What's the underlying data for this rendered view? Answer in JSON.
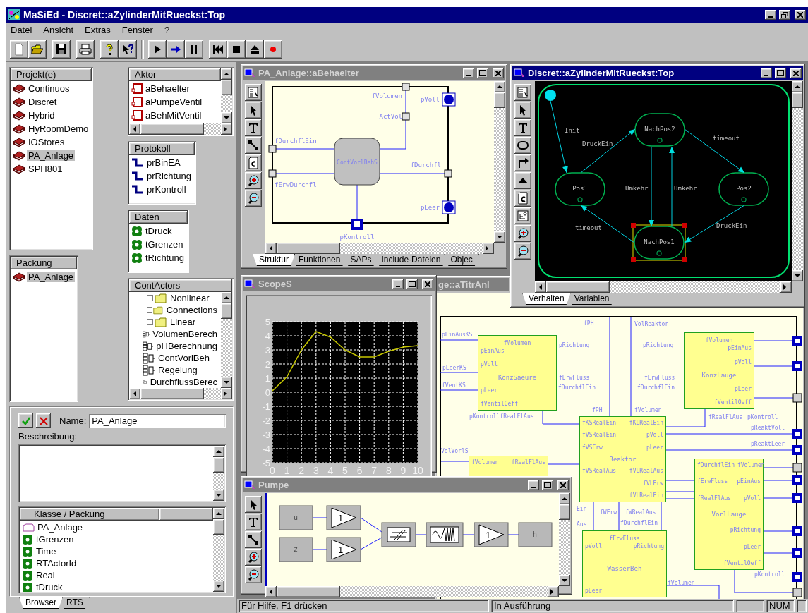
{
  "window": {
    "title": "MaSiEd - Discret::aZylinderMitRueckst:Top"
  },
  "menu": [
    "Datei",
    "Ansicht",
    "Extras",
    "Fenster",
    "?"
  ],
  "browser": {
    "projects": {
      "header": "Projekt(e)",
      "items": [
        {
          "label": "Continuos",
          "selected": false
        },
        {
          "label": "Discret",
          "selected": false
        },
        {
          "label": "Hybrid",
          "selected": false
        },
        {
          "label": "HyRoomDemo",
          "selected": false
        },
        {
          "label": "IOStores",
          "selected": false
        },
        {
          "label": "PA_Anlage",
          "selected": true
        },
        {
          "label": "SPH801",
          "selected": false
        }
      ]
    },
    "package": {
      "header": "Packung",
      "items": [
        {
          "label": "PA_Anlage",
          "selected": true
        }
      ]
    },
    "actors": {
      "header": "Aktor",
      "items": [
        "aBehaelter",
        "aPumpeVentil",
        "aBehMitVentil"
      ]
    },
    "protocols": {
      "header": "Protokoll",
      "items": [
        "prBinEA",
        "prRichtung",
        "prKontroll"
      ]
    },
    "data": {
      "header": "Daten",
      "items": [
        "tDruck",
        "tGrenzen",
        "tRichtung"
      ]
    },
    "cont_actors": {
      "header": "ContActors",
      "items": [
        {
          "label": "Nonlinear",
          "kind": "folder",
          "expanded": false
        },
        {
          "label": "Connections",
          "kind": "folder",
          "expanded": false
        },
        {
          "label": "Linear",
          "kind": "folder",
          "expanded": false
        },
        {
          "label": "VolumenBerech",
          "kind": "block"
        },
        {
          "label": "pHBerechnung",
          "kind": "block"
        },
        {
          "label": "ContVorlBeh",
          "kind": "block"
        },
        {
          "label": "Regelung",
          "kind": "block"
        },
        {
          "label": "DurchflussBerec",
          "kind": "block"
        }
      ]
    },
    "editor": {
      "name_label": "Name:",
      "name_value": "PA_Anlage",
      "description_label": "Beschreibung:",
      "class_column": "Klasse / Packung",
      "classes": [
        {
          "label": "PA_Anlage",
          "kind": "package"
        },
        {
          "label": "tGrenzen",
          "kind": "data"
        },
        {
          "label": "Time",
          "kind": "data"
        },
        {
          "label": "RTActorId",
          "kind": "data"
        },
        {
          "label": "Real",
          "kind": "data"
        },
        {
          "label": "tDruck",
          "kind": "data"
        }
      ]
    },
    "tabs": [
      {
        "label": "Browser",
        "selected": true
      },
      {
        "label": "RTS",
        "selected": false
      }
    ]
  },
  "structure_window": {
    "title": "PA_Anlage::aBehaelter",
    "active": false,
    "block": "ContVorlBehS",
    "ports": [
      "fVolumen",
      "ActVol",
      "pVoll",
      "fDurchflEin",
      "fErwDurchfl",
      "fDurchfl",
      "pLeer",
      "pKontroll"
    ],
    "tabs": [
      {
        "label": "Struktur",
        "selected": true
      },
      {
        "label": "Funktionen",
        "selected": false
      },
      {
        "label": "SAPs",
        "selected": false
      },
      {
        "label": "Include-Dateien",
        "selected": false
      },
      {
        "label": "Objec",
        "selected": false
      }
    ]
  },
  "statechart_window": {
    "title": "Discret::aZylinderMitRueckst:Top",
    "active": true,
    "states": [
      {
        "name": "NachPos2",
        "selected": false
      },
      {
        "name": "Pos1",
        "selected": false
      },
      {
        "name": "Pos2",
        "selected": false
      },
      {
        "name": "NachPos1",
        "selected": true
      }
    ],
    "transitions": [
      "Init",
      "DruckEin",
      "timeout",
      "Umkehr",
      "Umkehr",
      "timeout",
      "DruckEin"
    ],
    "tabs": [
      {
        "label": "Verhalten",
        "selected": true
      },
      {
        "label": "Variablen",
        "selected": false
      }
    ]
  },
  "system_window": {
    "title": "ge::aTitrAnl",
    "active": false,
    "blocks": [
      {
        "name": "KonzSaeure",
        "top": [
          "fVolumen"
        ],
        "left": [
          "pEinAus",
          "pVoll",
          "pLeer",
          "fVentilOeff"
        ]
      },
      {
        "name": "KonzLauge",
        "top": [
          "fVolumen"
        ],
        "right": [
          "pEinAus",
          "pVoll",
          "pLeer",
          "fVentilOeff"
        ]
      },
      {
        "left": [
          "fVolumen"
        ],
        "right": [
          "fRealFlAus"
        ]
      },
      {
        "name": "Reaktor",
        "left": [
          "fKSRealEin",
          "fVSRealEin",
          "fVSErw",
          "fVSRealAus"
        ],
        "right": [
          "fKLRealEin",
          "pVoll",
          "pLeer",
          "fVLRealAus",
          "fVLErw",
          "fVLRealEin"
        ]
      },
      {
        "name": "VorlLauge",
        "left": [
          "fDurchflEin",
          "fErwFluss",
          "fRealFlAus"
        ],
        "right": [
          "fVolumen",
          "pEinAus",
          "pVoll",
          "pRichtung",
          "pLeer",
          "fVentilOeff"
        ]
      },
      {
        "name": "WasserBeh",
        "top": [
          "fErwFluss"
        ],
        "left": [
          "pVoll",
          "pLeer"
        ],
        "right": [
          "pRichtung"
        ]
      }
    ],
    "labels": [
      "fPH",
      "VolReaktor",
      "pEinAusKS",
      "pRichtung",
      "pRichtung",
      "pLeerKS",
      "fErwFluss",
      "fErwFluss",
      "fDurchflEin",
      "fDurchflEin",
      "fVentKS",
      "fPH",
      "fVolumen",
      "pKontrollfRealFlAus",
      "fRealFlAus",
      "pKontroll",
      "pReaktVoll",
      "pReaktLeer",
      "VolVorlS",
      "Ein",
      "fWErw",
      "fWRealAus",
      "fDurchflEin",
      "Aus",
      "pKontroll",
      "fVolumen"
    ]
  },
  "scope_window": {
    "title": "ScopeS",
    "active": false,
    "chart_data": {
      "type": "line",
      "x": [
        0,
        1,
        2,
        3,
        4,
        5,
        6,
        7,
        8,
        9,
        10
      ],
      "series": [
        {
          "color": "#c8c800",
          "values": [
            0.1,
            1.1,
            3.0,
            4.3,
            3.9,
            3.0,
            2.5,
            2.5,
            2.9,
            3.2,
            3.3
          ]
        }
      ],
      "xlim": [
        0,
        10
      ],
      "ylim": [
        -5,
        5
      ],
      "xticks": [
        0,
        1,
        2,
        3,
        4,
        5,
        6,
        7,
        8,
        9,
        10
      ],
      "yticks": [
        -5,
        -4,
        -3,
        -2,
        -1,
        0,
        1,
        2,
        3,
        4,
        5
      ],
      "grid": true
    }
  },
  "pump_window": {
    "title": "Pumpe",
    "active": false,
    "blocks": [
      {
        "kind": "source",
        "label": "u"
      },
      {
        "kind": "source",
        "label": "z"
      },
      {
        "kind": "gain",
        "label": "1"
      },
      {
        "kind": "gain",
        "label": "1"
      },
      {
        "kind": "hysteresis"
      },
      {
        "kind": "wave"
      },
      {
        "kind": "gain",
        "label": "1"
      },
      {
        "kind": "source",
        "label": "h"
      }
    ]
  },
  "status_bar": [
    "Für Hilfe, F1 drücken",
    "In Ausführung",
    "NUM"
  ]
}
